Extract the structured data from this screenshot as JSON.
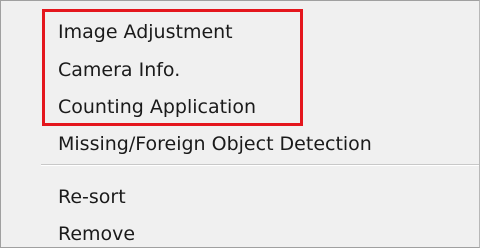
{
  "menu": {
    "items": [
      {
        "label": "Image Adjustment"
      },
      {
        "label": "Camera Info."
      },
      {
        "label": "Counting Application"
      },
      {
        "label": "Missing/Foreign Object Detection"
      },
      {
        "label": "Re-sort"
      },
      {
        "label": "Remove"
      }
    ]
  },
  "colors": {
    "menu_background": "#f0f0f0",
    "highlight_box": "#e4161d",
    "text": "#1a1a1a"
  }
}
